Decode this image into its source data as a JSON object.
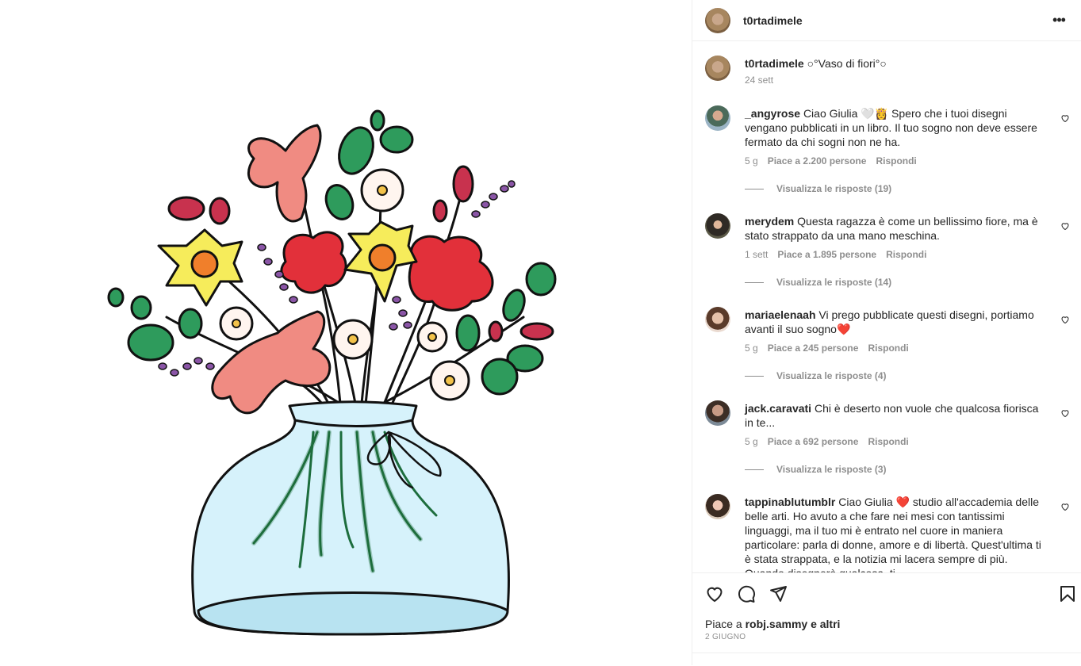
{
  "post": {
    "username": "t0rtadimele",
    "caption": "○°Vaso di fiori°○",
    "time": "24 sett",
    "more_icon": "more-horizontal-icon"
  },
  "comments": [
    {
      "username": "_angyrose",
      "text": "Ciao Giulia 🤍👸 Spero che i tuoi disegni vengano pubblicati in un libro. Il tuo sogno non deve essere fermato da chi sogni non ne ha.",
      "time": "5 g",
      "likes": "Piace a 2.200 persone",
      "reply": "Rispondi",
      "view_replies": "Visualizza le risposte (19)"
    },
    {
      "username": "merydem",
      "text": "Questa ragazza è come un bellissimo fiore, ma è stato strappato da una mano meschina.",
      "time": "1 sett",
      "likes": "Piace a 1.895 persone",
      "reply": "Rispondi",
      "view_replies": "Visualizza le risposte (14)"
    },
    {
      "username": "mariaelenaah",
      "text": "Vi prego pubblicate questi disegni, portiamo avanti il suo sogno❤️",
      "time": "5 g",
      "likes": "Piace a 245 persone",
      "reply": "Rispondi",
      "view_replies": "Visualizza le risposte (4)"
    },
    {
      "username": "jack.caravati",
      "text": "Chi è deserto non vuole che qualcosa fiorisca in te...",
      "time": "5 g",
      "likes": "Piace a 692 persone",
      "reply": "Rispondi",
      "view_replies": "Visualizza le risposte (3)"
    },
    {
      "username": "tappinablutumblr",
      "text": "Ciao Giulia ❤️ studio all'accademia delle belle arti. Ho avuto a che fare nei mesi con tantissimi linguaggi, ma il tuo mi è entrato nel cuore in maniera particolare: parla di donne, amore e di libertà. Quest'ultima ti è stata strappata, e la notizia mi lacera sempre di più. Quando disegnerò qualcosa, ti"
    }
  ],
  "footer": {
    "likes_prefix": "Piace a",
    "likes_user": "robj.sammy",
    "likes_suffix": "e altri",
    "date": "2 GIUGNO"
  }
}
